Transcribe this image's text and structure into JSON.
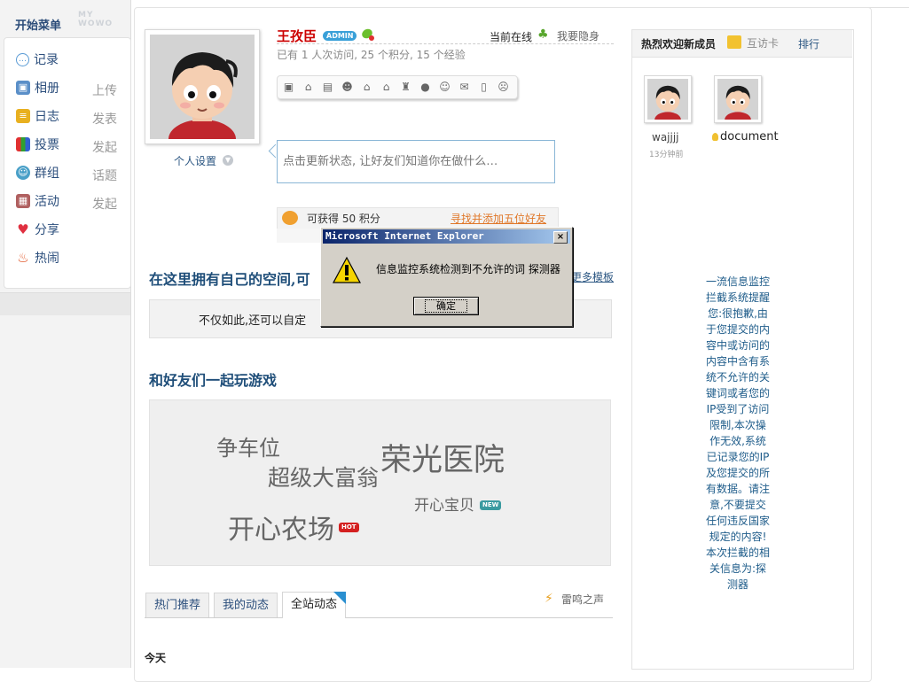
{
  "sidebar": {
    "title": "开始菜单",
    "watermark": "MY WOWO",
    "items": [
      {
        "label": "记录",
        "icon": "speech-bubble-icon",
        "side": ""
      },
      {
        "label": "相册",
        "icon": "photo-album-icon",
        "side": "上传"
      },
      {
        "label": "日志",
        "icon": "journal-icon",
        "side": "发表"
      },
      {
        "label": "投票",
        "icon": "poll-chart-icon",
        "side": "发起"
      },
      {
        "label": "群组",
        "icon": "group-icon",
        "side": "话题"
      },
      {
        "label": "活动",
        "icon": "calendar-icon",
        "side": "发起"
      },
      {
        "label": "分享",
        "icon": "heart-share-icon",
        "side": ""
      },
      {
        "label": "热闹",
        "icon": "fire-icon",
        "side": ""
      }
    ]
  },
  "profile": {
    "name": "王孜臣",
    "badge": "ADMIN",
    "online": "当前在线",
    "invisible": "我要隐身",
    "stats": "已有  1 人次访问, 25 个积分, 15 个经验",
    "settings": "个人设置",
    "status_placeholder": "点击更新状态, 让好友们知道你在做什么…"
  },
  "reward": {
    "text": "可获得  50 积分",
    "link": "寻找并添加五位好友"
  },
  "space_section": {
    "title": "在这里拥有自己的空间,可",
    "more": "更多模板",
    "text": "不仅如此,还可以自定"
  },
  "games": {
    "title": "和好友们一起玩游戏",
    "items": [
      "争车位",
      "超级大富翁",
      "荣光医院",
      "开心宝贝",
      "开心农场"
    ],
    "badge_new": "NEW",
    "badge_hot": "HOT"
  },
  "tabs": [
    "热门推荐",
    "我的动态",
    "全站动态"
  ],
  "thunder": "雷鸣之声",
  "today": "今天",
  "right": {
    "title": "热烈欢迎新成员",
    "card": "互访卡",
    "rank": "排行",
    "members": [
      {
        "name": "wajjjj",
        "time": "13分钟前"
      },
      {
        "name": "document",
        "time": ""
      }
    ],
    "warning": "一流信息监控拦截系统提醒您:很抱歉,由于您提交的内容中或访问的内容中含有系统不允许的关键词或者您的IP受到了访问限制,本次操作无效,系统已记录您的IP及您提交的所有数据。请注意,不要提交任何违反国家规定的内容!本次拦截的相关信息为:探测器"
  },
  "dialog": {
    "title": "Microsoft Internet Explorer",
    "message": "信息监控系统检测到不允许的词 探测器",
    "ok": "确定",
    "close": "×"
  }
}
